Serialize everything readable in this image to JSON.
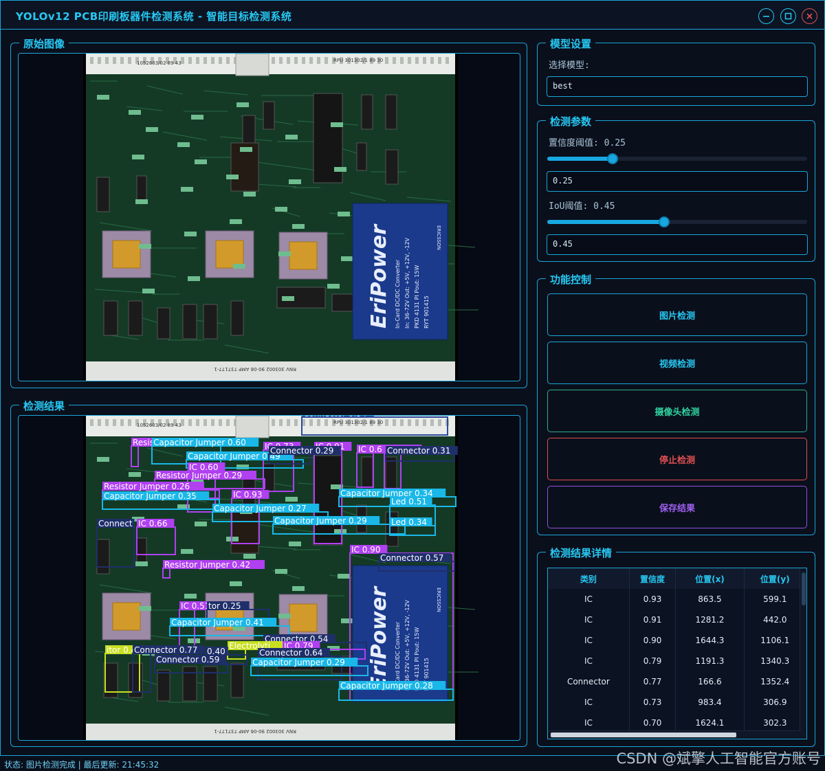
{
  "window": {
    "title": "YOLOv12 PCB印刷板器件检测系统 - 智能目标检测系统"
  },
  "original_panel": {
    "title": "原始图像"
  },
  "result_panel": {
    "title": "检测结果"
  },
  "pcb": {
    "top_label_left": "1052603/02  89 43",
    "top_label_right": "RPU 301302/1  89 30",
    "bottom_label": "RNV 303002 90-06 AMP 737177-1",
    "module_brand": "EriPower",
    "module_line1": "In-Card DC/DC Converter",
    "module_line2": "In: 36-72V  Out: +5V, +12V, -12V",
    "module_line3": "PKD 4131 PI  Pout: 15W",
    "module_line4": "RYT 901415",
    "module_maker": "ERICSSON"
  },
  "detections_overlay": [
    {
      "label": "Connector 0.54",
      "color": "#2a4a9a"
    },
    {
      "label": "Resis",
      "color": "#b040f0"
    },
    {
      "label": "Capacitor Jumper 0.60",
      "color": "#1ab8e8"
    },
    {
      "label": "IC 0.73",
      "color": "#b040f0"
    },
    {
      "label": "IC 0.91",
      "color": "#b040f0"
    },
    {
      "label": "IC 0.6",
      "color": "#b040f0"
    },
    {
      "label": "IC 0.70",
      "color": "#b040f0"
    },
    {
      "label": "Connector 0.31",
      "color": "#1f2f6a"
    },
    {
      "label": "Capacitor Jumper 0.49",
      "color": "#1ab8e8"
    },
    {
      "label": "Connector 0.29",
      "color": "#1f2f6a"
    },
    {
      "label": "IC 0.60",
      "color": "#b040f0"
    },
    {
      "label": "Resistor Jumper 0.29",
      "color": "#b040f0"
    },
    {
      "label": "Resistor Jumper 0.26",
      "color": "#b040f0"
    },
    {
      "label": "Capacitor Jumper 0.35",
      "color": "#1ab8e8"
    },
    {
      "label": "IC 0.93",
      "color": "#b040f0"
    },
    {
      "label": "Capacitor Jumper 0.34",
      "color": "#1ab8e8"
    },
    {
      "label": "Led 0.51",
      "color": "#1ab8e8"
    },
    {
      "label": "Capacitor Jumper 0.27",
      "color": "#1ab8e8"
    },
    {
      "label": "Capacitor Jumper 0.29",
      "color": "#1ab8e8"
    },
    {
      "label": "Led 0.34",
      "color": "#1ab8e8"
    },
    {
      "label": "Connect",
      "color": "#1f2f6a"
    },
    {
      "label": "IC 0.66",
      "color": "#b040f0"
    },
    {
      "label": "IC 0.90",
      "color": "#b040f0"
    },
    {
      "label": "Connector 0.57",
      "color": "#1f2f6a"
    },
    {
      "label": "Resistor Jumper 0.42",
      "color": "#b040f0"
    },
    {
      "label": "IC 0.51",
      "color": "#b040f0"
    },
    {
      "label": "tor 0.25",
      "color": "#1f2f6a"
    },
    {
      "label": "Capacitor Jumper 0.41",
      "color": "#1ab8e8"
    },
    {
      "label": "Connector 0.54",
      "color": "#1f2f6a"
    },
    {
      "label": "Electrolyti",
      "color": "#c8e020"
    },
    {
      "label": "IC 0.79",
      "color": "#b040f0"
    },
    {
      "label": "itor 0.41",
      "color": "#c8e020"
    },
    {
      "label": "Connector 0.77",
      "color": "#1f2f6a"
    },
    {
      "label": "0.40",
      "color": "#1f2f6a"
    },
    {
      "label": "Connector 0.64",
      "color": "#1f2f6a"
    },
    {
      "label": "Connector 0.59",
      "color": "#1f2f6a"
    },
    {
      "label": "Capacitor Jumper 0.29",
      "color": "#1ab8e8"
    },
    {
      "label": "Capacitor Jumper 0.28",
      "color": "#1ab8e8"
    }
  ],
  "model": {
    "title": "模型设置",
    "select_label": "选择模型:",
    "selected": "best"
  },
  "params": {
    "title": "检测参数",
    "conf_label": "置信度阈值: 0.25",
    "conf_value": "0.25",
    "conf_level": 0.25,
    "iou_label": "IoU阈值: 0.45",
    "iou_value": "0.45",
    "iou_level": 0.45
  },
  "controls": {
    "title": "功能控制",
    "image_detect": "图片检测",
    "video_detect": "视频检测",
    "camera_detect": "摄像头检测",
    "stop_detect": "停止检测",
    "save_result": "保存结果"
  },
  "details": {
    "title": "检测结果详情",
    "columns": [
      "类别",
      "置信度",
      "位置(x)",
      "位置(y)"
    ],
    "rows": [
      [
        "IC",
        "0.93",
        "863.5",
        "599.1"
      ],
      [
        "IC",
        "0.91",
        "1281.2",
        "442.0"
      ],
      [
        "IC",
        "0.90",
        "1644.3",
        "1106.1"
      ],
      [
        "IC",
        "0.79",
        "1191.3",
        "1340.3"
      ],
      [
        "Connector",
        "0.77",
        "166.6",
        "1352.4"
      ],
      [
        "IC",
        "0.73",
        "983.4",
        "306.9"
      ],
      [
        "IC",
        "0.70",
        "1624.1",
        "302.3"
      ]
    ]
  },
  "status": {
    "text": "状态: 图片检测完成 | 最后更新: 21:45:32"
  },
  "watermark": "CSDN @斌擎人工智能官方账号",
  "colors": {
    "accent": "#27c8f2",
    "border": "#1aa7d8",
    "stop": "#e05050",
    "camera": "#2fd0a0",
    "save": "#a060f0"
  }
}
